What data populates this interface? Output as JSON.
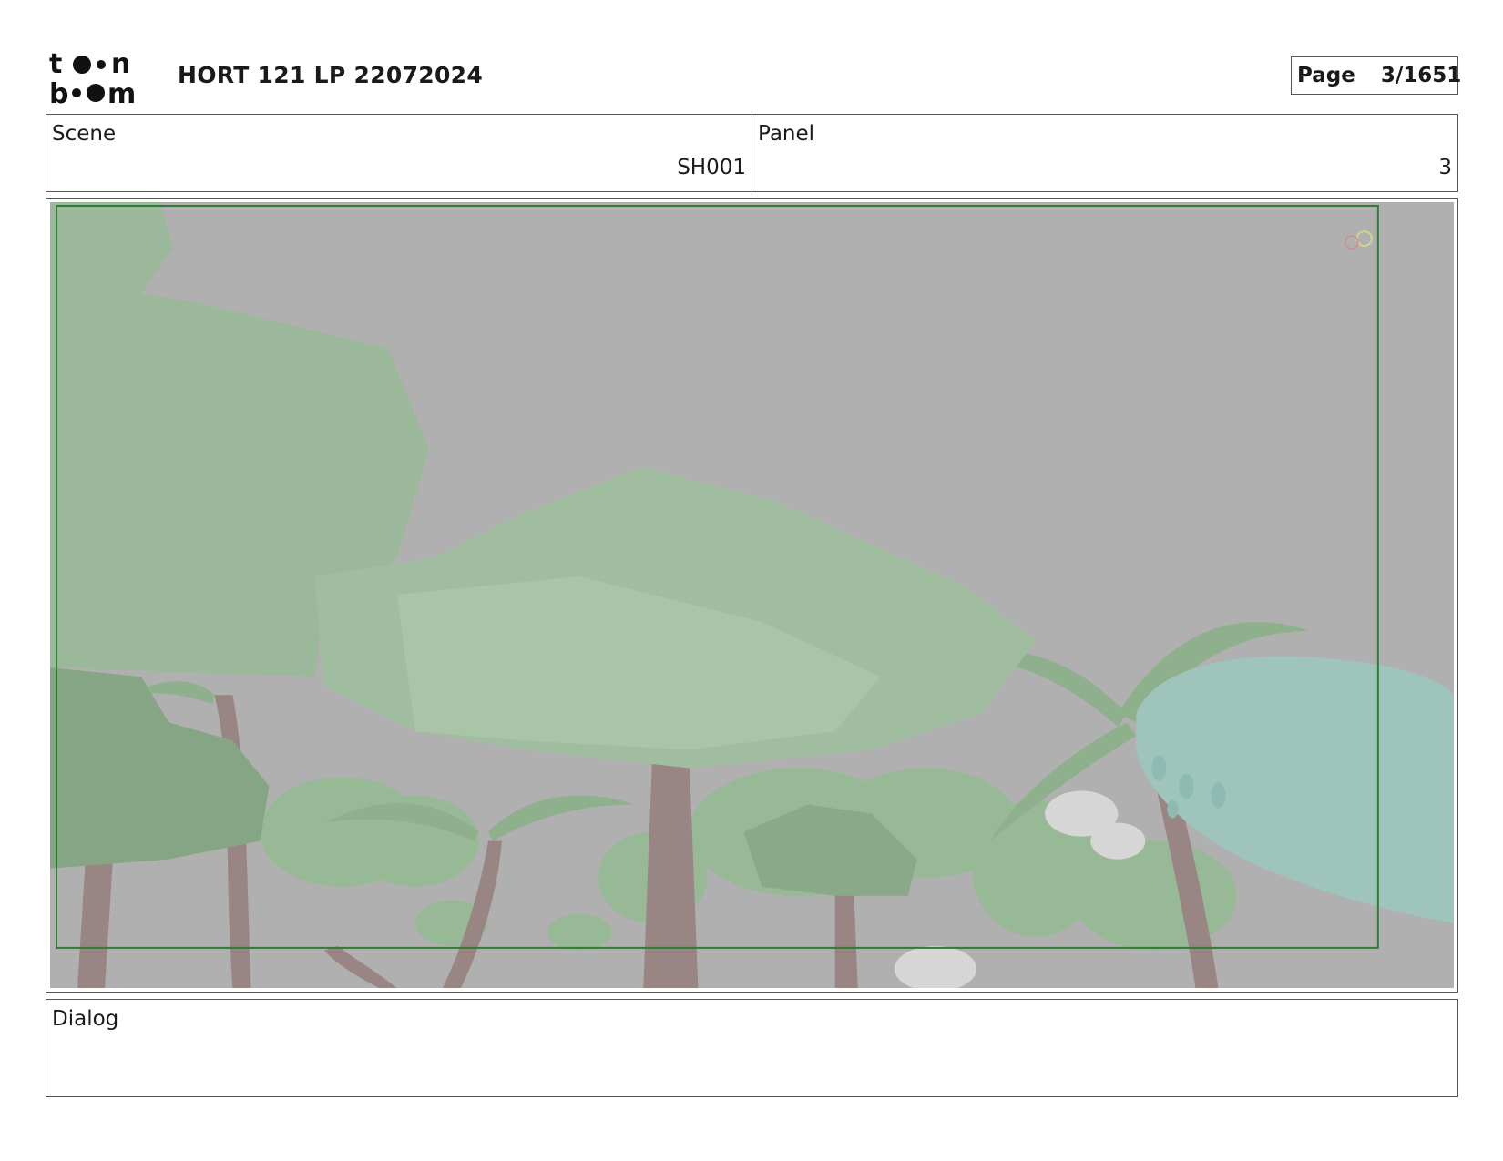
{
  "header": {
    "logo_name": "toon boom",
    "title": "HORT 121 LP 22072024",
    "page_label": "Page",
    "page_value": "3/1651"
  },
  "info": {
    "scene_label": "Scene",
    "scene_value": "SH001",
    "panel_label": "Panel",
    "panel_value": "3"
  },
  "panel_image": {
    "description_icon": "storyboard-3d-jungle-frame",
    "colors": {
      "sky": "#b0b0b0",
      "foliage": "#9cb89a",
      "foliage_dark": "#86a584",
      "trunk": "#9a8585",
      "teal_plant": "#9fc4bc",
      "frame_border": "#2e7d32"
    }
  },
  "dialog": {
    "label": "Dialog",
    "text": ""
  }
}
